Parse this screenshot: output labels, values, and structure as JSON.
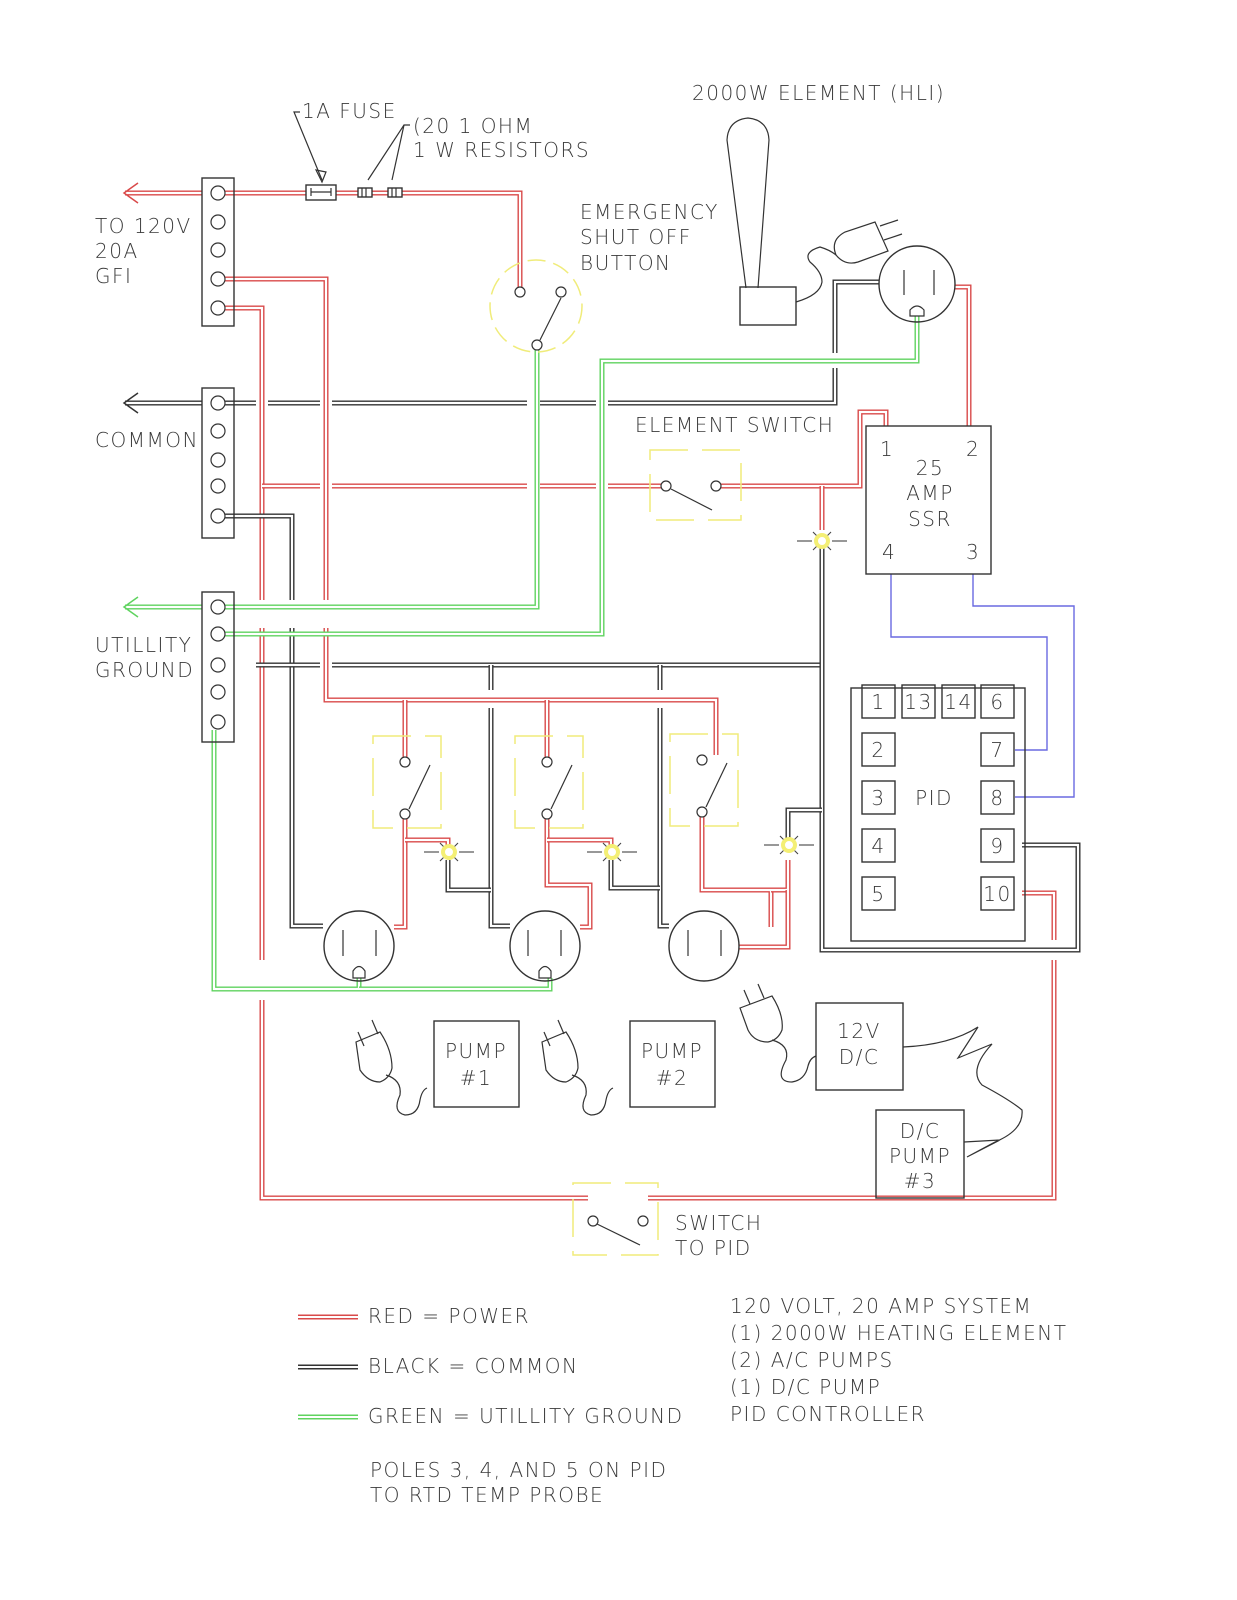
{
  "colors": {
    "power": "#d94a4a",
    "common": "#333333",
    "ground": "#5fd35f",
    "signal": "#6a6ae0",
    "switch_frame": "#f0ec7a"
  },
  "labels": {
    "fuse": "1A FUSE",
    "resistors_line1": "(20 1 OHM",
    "resistors_line2": "1 W RESISTORS",
    "element_title": "2000W ELEMENT (HLI)",
    "estop_line1": "EMERGENCY",
    "estop_line2": "SHUT OFF",
    "estop_line3": "BUTTON",
    "supply_line1": "TO 120V",
    "supply_line2": "20A",
    "supply_line3": "GFI",
    "common": "COMMON",
    "ground_line1": "UTILLITY",
    "ground_line2": "GROUND",
    "element_switch": "ELEMENT SWITCH",
    "pid_switch_line1": "SWITCH",
    "pid_switch_line2": "TO PID"
  },
  "ssr": {
    "line1": "25",
    "line2": "AMP",
    "line3": "SSR",
    "terminals": [
      "1",
      "2",
      "4",
      "3"
    ]
  },
  "pid": {
    "label": "PID",
    "terminals_top": [
      "1",
      "13",
      "14",
      "6"
    ],
    "terminals_left": [
      "2",
      "3",
      "4",
      "5"
    ],
    "terminals_right": [
      "7",
      "8",
      "9",
      "10"
    ]
  },
  "devices": {
    "pump1_line1": "PUMP",
    "pump1_line2": "#1",
    "pump2_line1": "PUMP",
    "pump2_line2": "#2",
    "dc_supply_line1": "12V",
    "dc_supply_line2": "D/C",
    "pump3_line1": "D/C",
    "pump3_line2": "PUMP",
    "pump3_line3": "#3"
  },
  "legend": [
    {
      "color_key": "power",
      "label": "RED = POWER"
    },
    {
      "color_key": "common",
      "label": "BLACK = COMMON"
    },
    {
      "color_key": "ground",
      "label": "GREEN = UTILLITY GROUND"
    }
  ],
  "notes": {
    "poles_line1": "POLES 3, 4, AND 5 ON PID",
    "poles_line2": "TO RTD TEMP PROBE"
  },
  "system_summary": [
    "120 VOLT, 20 AMP SYSTEM",
    "(1) 2000W HEATING ELEMENT",
    "(2) A/C PUMPS",
    "(1) D/C PUMP",
    "PID CONTROLLER"
  ]
}
